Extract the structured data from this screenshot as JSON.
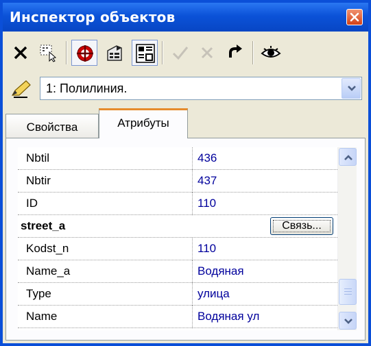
{
  "window": {
    "title": "Инспектор объектов",
    "title_bar_color": "#0b4fd8",
    "accent_tab_color": "#e68b2c"
  },
  "toolbar": {
    "buttons": [
      {
        "icon": "delete-x-icon"
      },
      {
        "icon": "select-pointer-icon"
      },
      {
        "icon": "target-icon",
        "pressed": true
      },
      {
        "icon": "properties-card-icon"
      },
      {
        "icon": "layout-grid-icon",
        "pressed": true
      },
      {
        "icon": "apply-check-icon",
        "disabled": true
      },
      {
        "icon": "cancel-x-icon",
        "disabled": true
      },
      {
        "icon": "refresh-icon"
      },
      {
        "icon": "eye-icon"
      }
    ]
  },
  "object_selector": {
    "icon": "pencil-icon",
    "value": "1: Полилиния."
  },
  "tabs": [
    {
      "label": "Свойства",
      "active": false
    },
    {
      "label": "Атрибуты",
      "active": true
    }
  ],
  "attributes": {
    "rows": [
      {
        "name": "Nbtil",
        "value": "436"
      },
      {
        "name": "Nbtir",
        "value": "437"
      },
      {
        "name": "ID",
        "value": "110"
      }
    ],
    "group": {
      "name": "street_a",
      "button_label": "Связь..."
    },
    "group_rows": [
      {
        "name": "Kodst_n",
        "value": "110"
      },
      {
        "name": "Name_a",
        "value": "Водяная"
      },
      {
        "name": "Type",
        "value": "улица"
      },
      {
        "name": "Name",
        "value": "Водяная ул"
      }
    ]
  },
  "scrollbar": {
    "position_fraction": 0.85
  }
}
